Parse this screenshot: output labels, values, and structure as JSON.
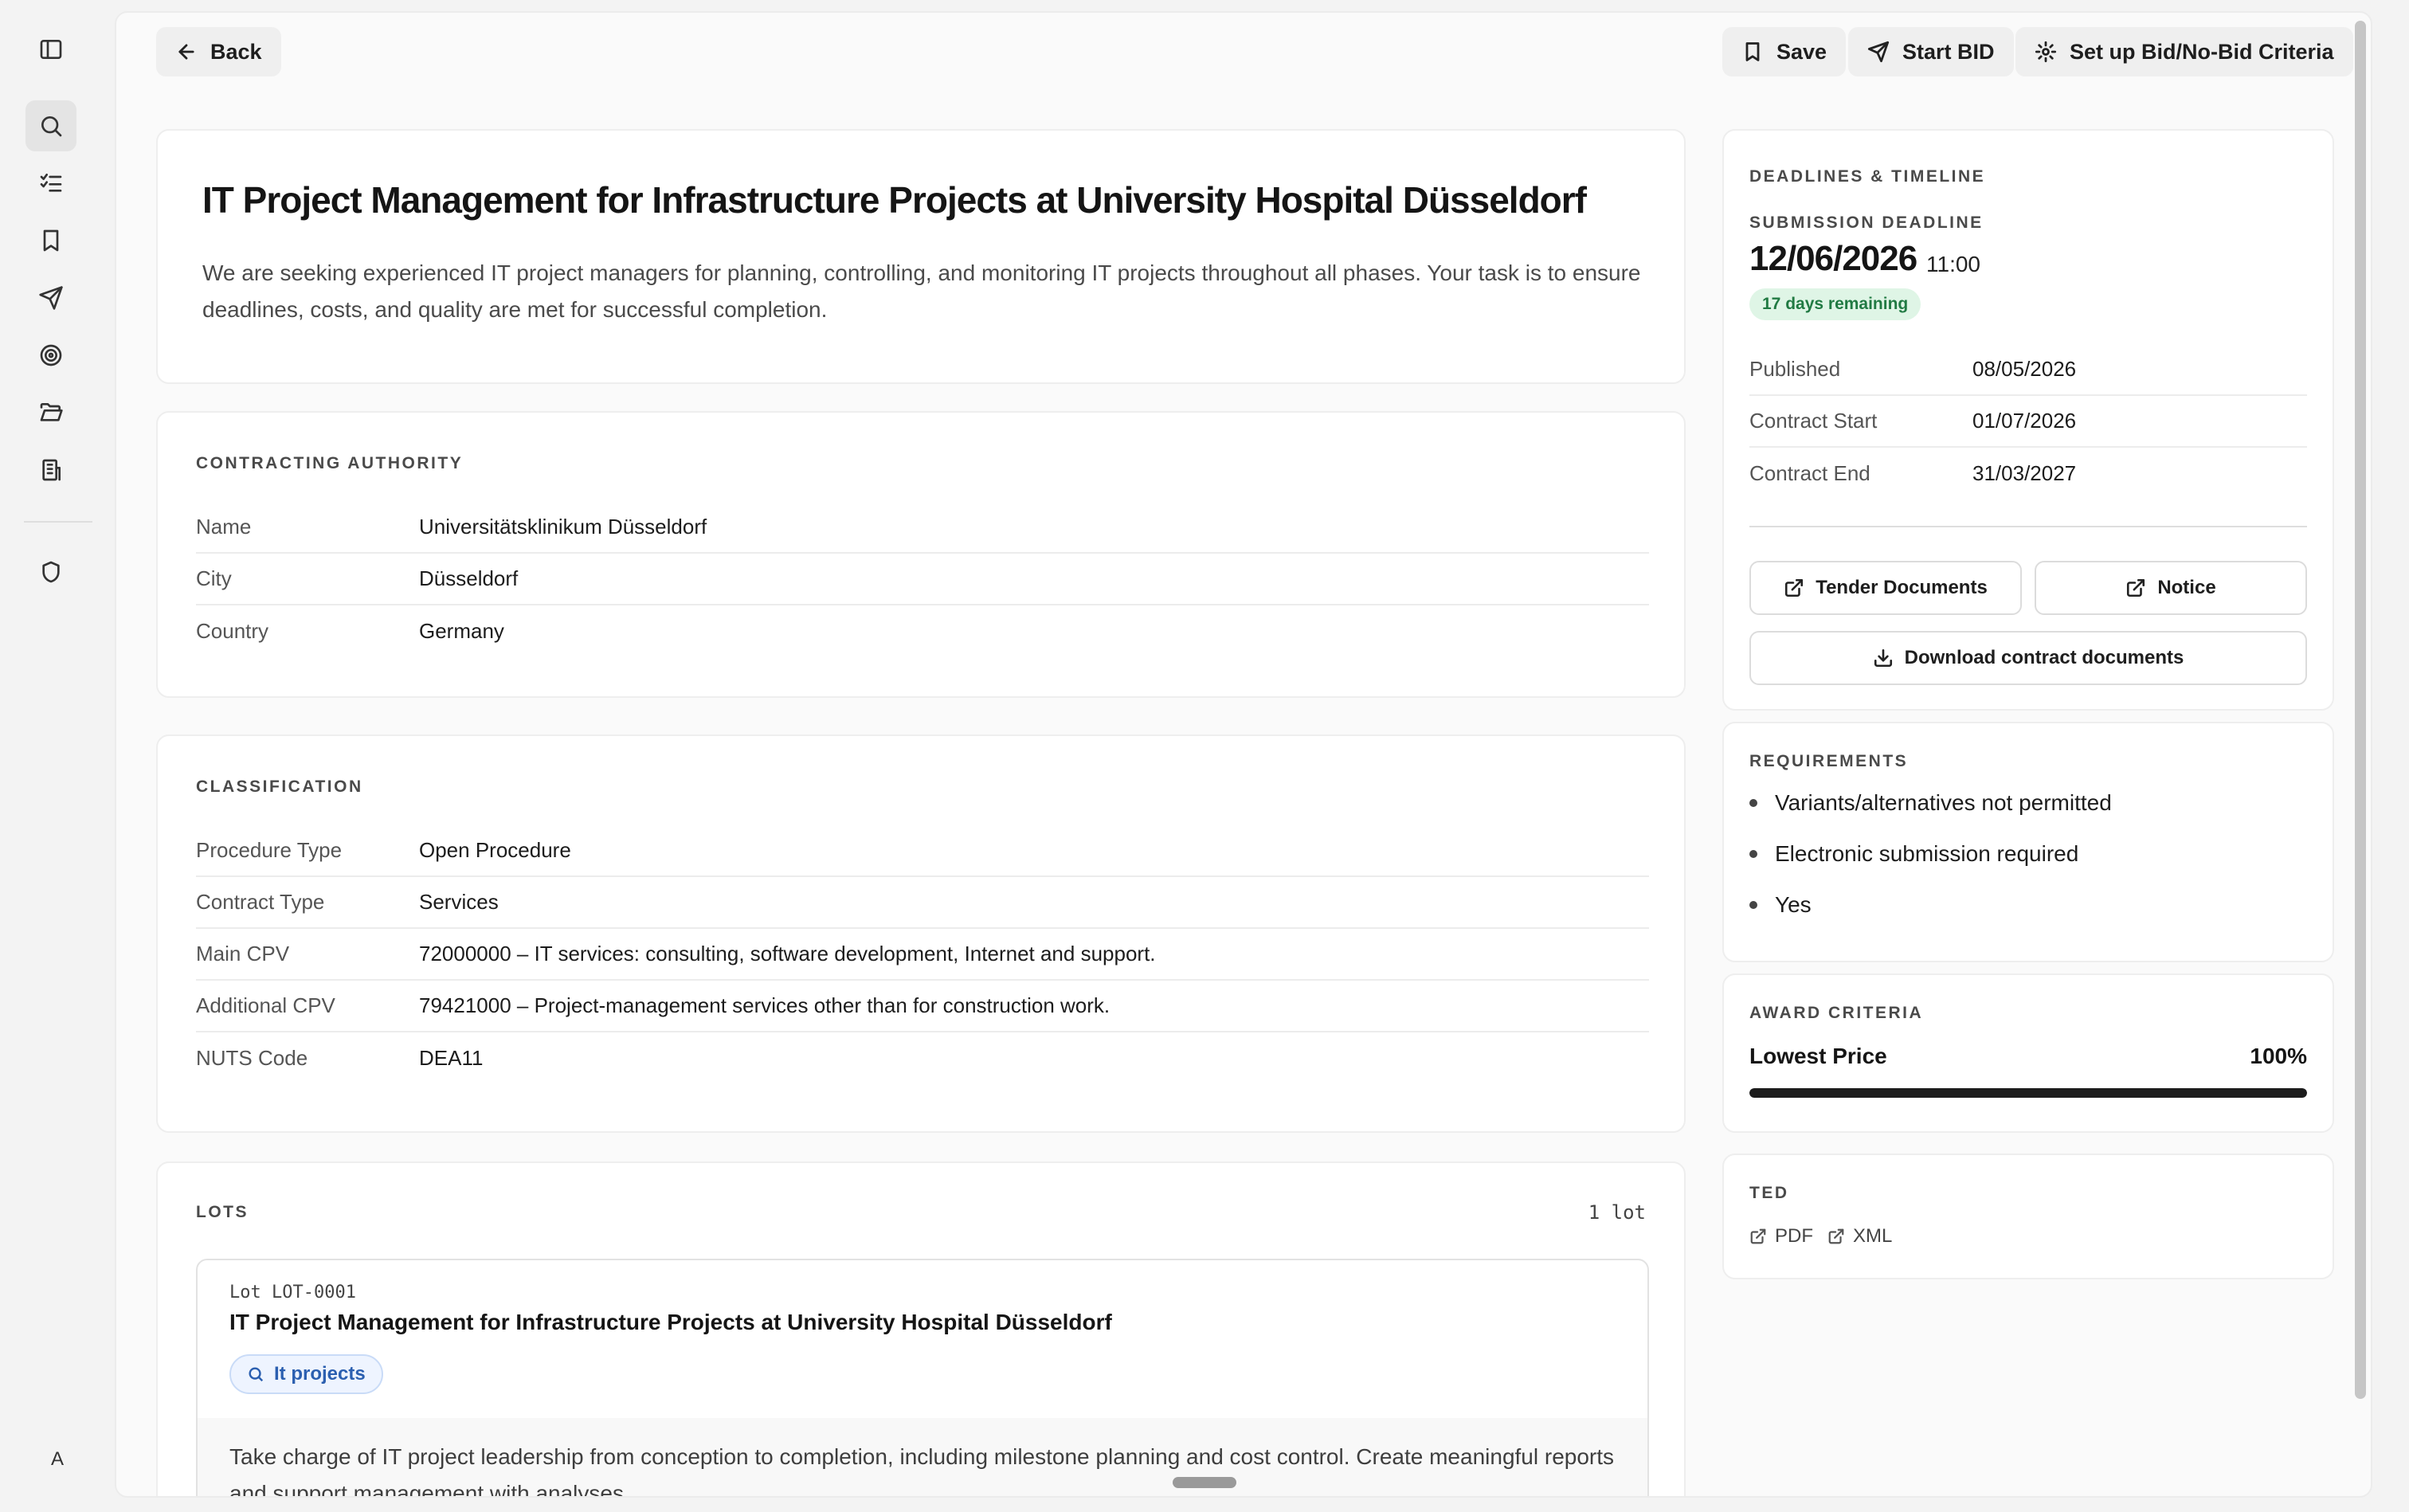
{
  "toolbar": {
    "back_label": "Back",
    "save_label": "Save",
    "start_bid_label": "Start BID",
    "criteria_label": "Set up Bid/No-Bid Criteria"
  },
  "rail": {
    "items": [
      "sidebar-toggle-icon",
      "search-icon",
      "checklist-icon",
      "bookmark-icon",
      "send-icon",
      "target-icon",
      "folder-open-icon",
      "building-icon",
      "shield-icon"
    ],
    "active": "search-icon",
    "avatar": "A"
  },
  "tender": {
    "title": "IT Project Management for Infrastructure Projects at University Hospital Düsseldorf",
    "description": "We are seeking experienced IT project managers for planning, controlling, and monitoring IT projects throughout all phases. Your task is to ensure deadlines, costs, and quality are met for successful completion."
  },
  "authority": {
    "label": "CONTRACTING AUTHORITY",
    "rows": [
      {
        "key": "Name",
        "value": "Universitätsklinikum Düsseldorf"
      },
      {
        "key": "City",
        "value": "Düsseldorf"
      },
      {
        "key": "Country",
        "value": "Germany"
      }
    ]
  },
  "classification": {
    "label": "CLASSIFICATION",
    "rows": [
      {
        "key": "Procedure Type",
        "value": "Open Procedure"
      },
      {
        "key": "Contract Type",
        "value": "Services"
      },
      {
        "key": "Main CPV",
        "value": "72000000 – IT services: consulting, software development, Internet and support."
      },
      {
        "key": "Additional CPV",
        "value": "79421000 – Project-management services other than for construction work."
      },
      {
        "key": "NUTS Code",
        "value": "DEA11"
      }
    ]
  },
  "lots": {
    "label": "LOTS",
    "count": "1 lot",
    "items": [
      {
        "id": "Lot LOT-0001",
        "title": "IT Project Management for Infrastructure Projects at University Hospital Düsseldorf",
        "tag": "It projects",
        "description": "Take charge of IT project leadership from conception to completion, including milestone planning and cost control. Create meaningful reports and support management with analyses."
      }
    ]
  },
  "timeline": {
    "label": "DEADLINES & TIMELINE",
    "deadline_label": "SUBMISSION DEADLINE",
    "deadline_date": "12/06/2026",
    "deadline_time": "11:00",
    "remaining": "17 days remaining",
    "rows": [
      {
        "key": "Published",
        "value": "08/05/2026"
      },
      {
        "key": "Contract Start",
        "value": "01/07/2026"
      },
      {
        "key": "Contract End",
        "value": "31/03/2027"
      }
    ],
    "tender_docs_label": "Tender Documents",
    "notice_label": "Notice",
    "download_label": "Download contract documents"
  },
  "requirements": {
    "label": "REQUIREMENTS",
    "items": [
      "Variants/alternatives not permitted",
      "Electronic submission required",
      "Yes"
    ]
  },
  "award": {
    "label": "AWARD CRITERIA",
    "name": "Lowest Price",
    "percent_label": "100%",
    "weight": 1.0
  },
  "ted": {
    "label": "TED",
    "pdf_label": "PDF",
    "xml_label": "XML"
  }
}
